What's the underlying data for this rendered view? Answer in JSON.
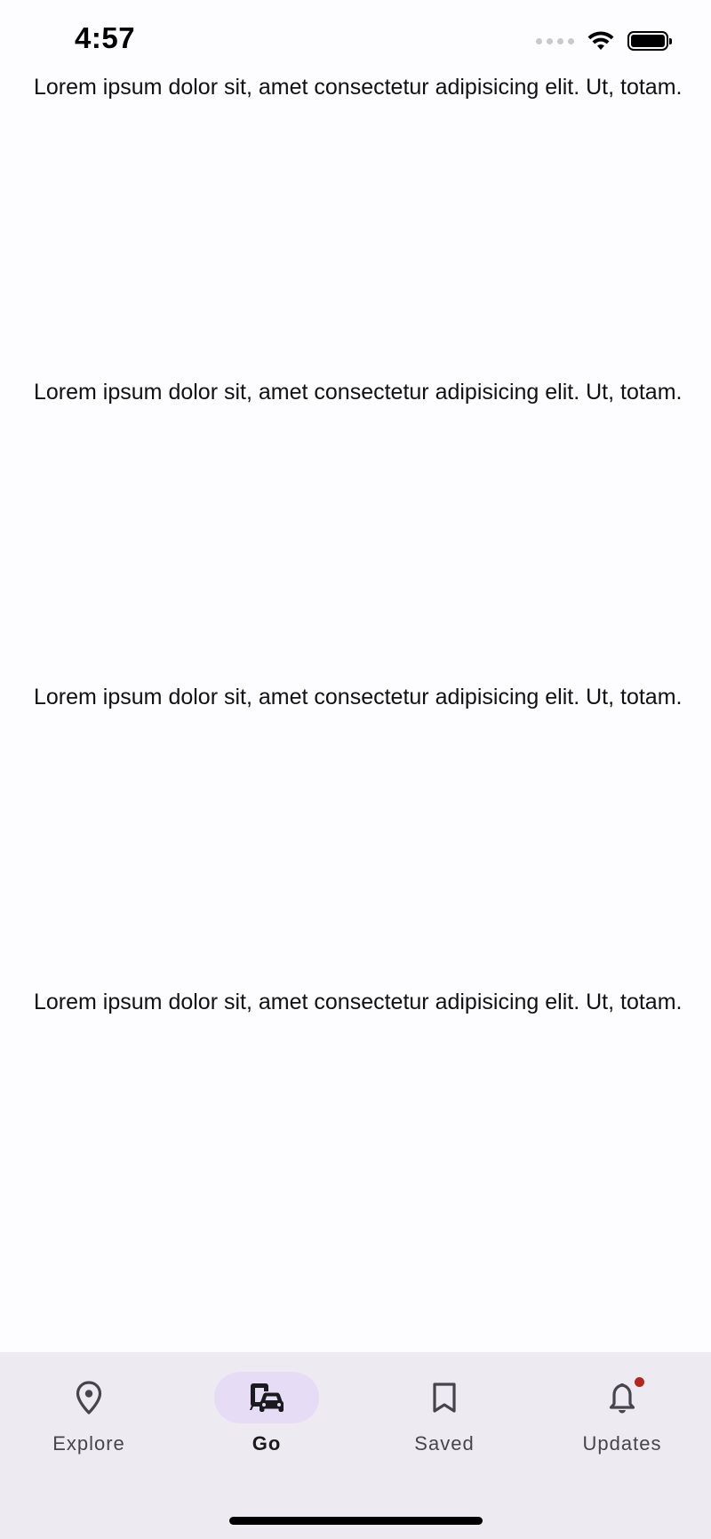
{
  "status_bar": {
    "time": "4:57"
  },
  "content": {
    "paragraphs": [
      "Lorem ipsum dolor sit, amet consectetur adipisicing elit. Ut, totam.",
      "Lorem ipsum dolor sit, amet consectetur adipisicing elit. Ut, totam.",
      "Lorem ipsum dolor sit, amet consectetur adipisicing elit. Ut, totam.",
      "Lorem ipsum dolor sit, amet consectetur adipisicing elit. Ut, totam."
    ]
  },
  "bottom_nav": {
    "items": [
      {
        "label": "Explore",
        "icon": "location-pin-icon",
        "active": false
      },
      {
        "label": "Go",
        "icon": "commute-icon",
        "active": true
      },
      {
        "label": "Saved",
        "icon": "bookmark-icon",
        "active": false
      },
      {
        "label": "Updates",
        "icon": "bell-icon",
        "active": false,
        "badge": true
      }
    ],
    "colors": {
      "background": "#eeeaf1",
      "active_indicator": "#e6dcf6",
      "badge": "#b3261e"
    }
  }
}
